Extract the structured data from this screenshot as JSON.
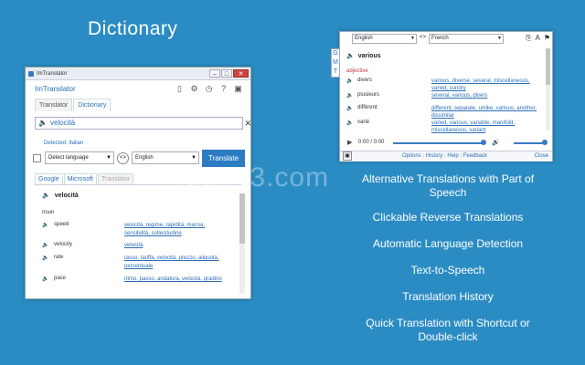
{
  "hero_title": "Dictionary",
  "watermark": "Hao743.com",
  "features": [
    "Alternative Translations with Part of Speech",
    "Clickable Reverse Translations",
    "Automatic Language Detection",
    "Text-to-Speech",
    "Translation History",
    "Quick Translation with Shortcut or Double-click"
  ],
  "window": {
    "title": "ImTranslator",
    "app_name": "ImTranslator",
    "tabs": [
      "Translator",
      "Dictionary"
    ],
    "source_text": "velocità",
    "detected": "Detected: Italian",
    "source_lang": "Detect language",
    "target_lang": "English",
    "translate_label": "Translate",
    "provider_tabs": [
      "Google",
      "Microsoft",
      "Translator"
    ],
    "word": "velocità",
    "pos": "noun",
    "rows": [
      {
        "w": "speed",
        "t": "velocità, regime, rapidità, marcia, sensibilità, sollecitudine"
      },
      {
        "w": "velocity",
        "t": "velocità"
      },
      {
        "w": "rate",
        "t": "tasso, tariffa, velocità, prezzo, aliquota, percentuale"
      },
      {
        "w": "pace",
        "t": "ritmo, passo, andatura, velocità, gradino"
      }
    ]
  },
  "popup": {
    "source_lang": "English",
    "target_lang": "French",
    "side_tabs": [
      "G",
      "M",
      "T"
    ],
    "word": "various",
    "pos": "adjective",
    "rows": [
      {
        "w": "divers",
        "t": "various, diverse, several, miscellaneous, varied, sundry"
      },
      {
        "w": "plusieurs",
        "t": "several, various, divers"
      },
      {
        "w": "différent",
        "t": "different, separate, unlike, various, another, dissimilar"
      },
      {
        "w": "varié",
        "t": "varied, various, variable, manifold, miscellaneous, variant"
      }
    ],
    "time": "0:00 / 0:00",
    "footer_links": "Options : History : Help : Feedback",
    "close_label": "Close"
  }
}
